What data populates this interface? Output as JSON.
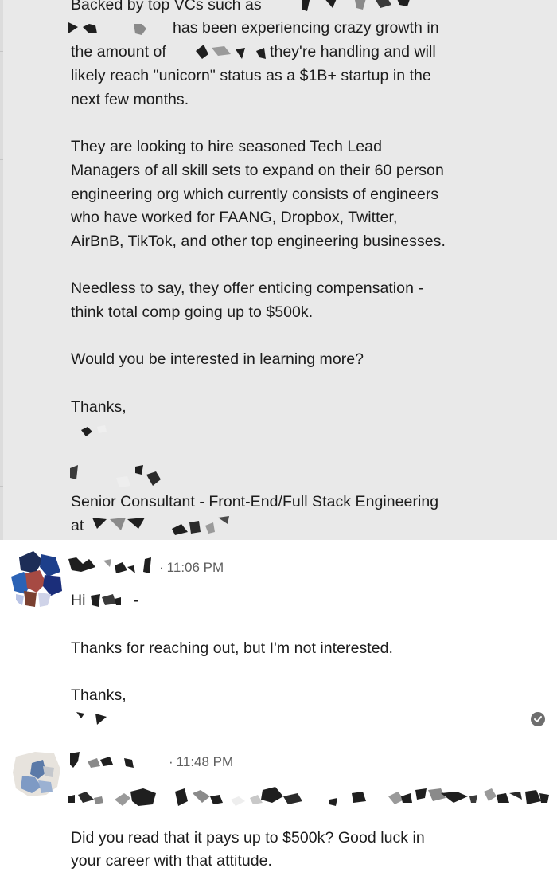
{
  "thread": {
    "first_message": {
      "lines_top": [
        "Backed by top VCs such as",
        "has been experiencing crazy growth in",
        "the amount of",
        "they're handling and will",
        "likely reach \"unicorn\" status as a $1B+ startup in the",
        "next few months."
      ],
      "paragraph_hiring": [
        "They are looking to hire seasoned Tech Lead",
        "Managers of all skill sets to expand on their 60 person",
        "engineering org which currently consists of engineers",
        "who have worked for FAANG, Dropbox, Twitter,",
        "AirBnB, TikTok, and other top engineering businesses."
      ],
      "paragraph_comp": [
        "Needless to say, they offer enticing compensation -",
        "think total comp going up to $500k."
      ],
      "question": "Would you be interested in learning more?",
      "signoff": "Thanks,",
      "title_line": "Senior Consultant - Front-End/Full Stack Engineering",
      "at_line": "at"
    },
    "reply": {
      "timestamp": "11:06 PM",
      "greeting": "Hi",
      "greeting_dash": "-",
      "body": "Thanks for reaching out, but I'm not interested.",
      "signoff": "Thanks,"
    },
    "recruiter_response": {
      "timestamp": "11:48 PM",
      "body_lines": [
        "Did you read that it pays up to $500k? Good luck in",
        "your career with that attitude."
      ]
    }
  },
  "colors": {
    "highlight_bg": "#e9e9e9",
    "text": "#1c1c1c",
    "timestamp": "#5f5f5f",
    "redaction": "#1f1f1f",
    "receipt": "#6e6e6e"
  },
  "icons": {
    "read_receipt": "check-circle-icon"
  }
}
